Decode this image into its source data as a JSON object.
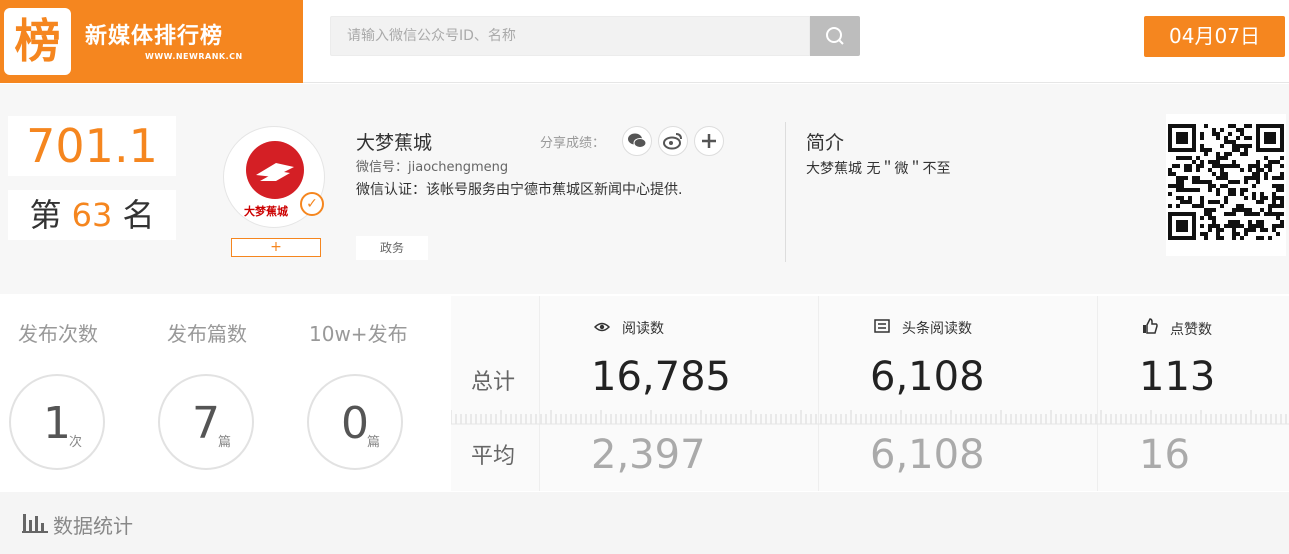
{
  "header": {
    "logo_char": "榜",
    "brand_title": "新媒体排行榜",
    "brand_url": "WWW.NEWRANK.CN",
    "search_placeholder": "请输入微信公众号ID、名称",
    "date": "04月07日",
    "accent_color": "#f5861f"
  },
  "profile": {
    "score": "701.1",
    "rank_prefix": "第",
    "rank_number": "63",
    "rank_suffix": "名",
    "follow_label": "+",
    "name": "大梦蕉城",
    "share_label": "分享成绩：",
    "share_icons": [
      "wechat-icon",
      "weibo-icon",
      "plus-icon"
    ],
    "wechat_id": "微信号：jiaochengmeng",
    "certification": "微信认证：该帐号服务由宁德市蕉城区新闻中心提供.",
    "tag": "政务",
    "avatar_text": "大梦蕉城",
    "intro_title": "简介",
    "intro_text": "大梦蕉城 无＂微＂不至"
  },
  "publish": {
    "items": [
      {
        "label": "发布次数",
        "value": "1",
        "unit": "次"
      },
      {
        "label": "发布篇数",
        "value": "7",
        "unit": "篇"
      },
      {
        "label": "10w+发布",
        "value": "0",
        "unit": "篇"
      }
    ]
  },
  "metrics": {
    "total_label": "总计",
    "avg_label": "平均",
    "columns": [
      {
        "label": "阅读数",
        "icon": "eye-icon",
        "total": "16,785",
        "avg": "2,397"
      },
      {
        "label": "头条阅读数",
        "icon": "headline-icon",
        "total": "6,108",
        "avg": "6,108"
      },
      {
        "label": "点赞数",
        "icon": "thumbs-up-icon",
        "total": "113",
        "avg": "16"
      }
    ]
  },
  "footer": {
    "title": "数据统计"
  }
}
